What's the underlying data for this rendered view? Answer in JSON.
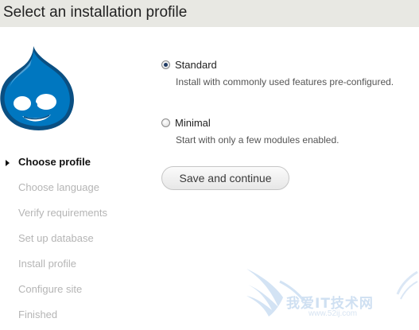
{
  "header": {
    "title": "Select an installation profile"
  },
  "logo": {
    "icon": "drupal-drop-icon",
    "brand_color": "#0077c0"
  },
  "steps": [
    {
      "label": "Choose profile",
      "state": "active"
    },
    {
      "label": "Choose language",
      "state": "pending"
    },
    {
      "label": "Verify requirements",
      "state": "pending"
    },
    {
      "label": "Set up database",
      "state": "pending"
    },
    {
      "label": "Install profile",
      "state": "pending"
    },
    {
      "label": "Configure site",
      "state": "pending"
    },
    {
      "label": "Finished",
      "state": "pending"
    }
  ],
  "profiles": [
    {
      "label": "Standard",
      "description": "Install with commonly used features pre-configured.",
      "selected": true
    },
    {
      "label": "Minimal",
      "description": "Start with only a few modules enabled.",
      "selected": false
    }
  ],
  "form": {
    "submit_label": "Save and continue"
  },
  "watermark": {
    "text": "我爱IT技术网",
    "url": "www.52ij.com"
  },
  "colors": {
    "header_bg": "#e8e8e3",
    "inactive_step": "#b5b5b5",
    "active_step": "#111111"
  }
}
